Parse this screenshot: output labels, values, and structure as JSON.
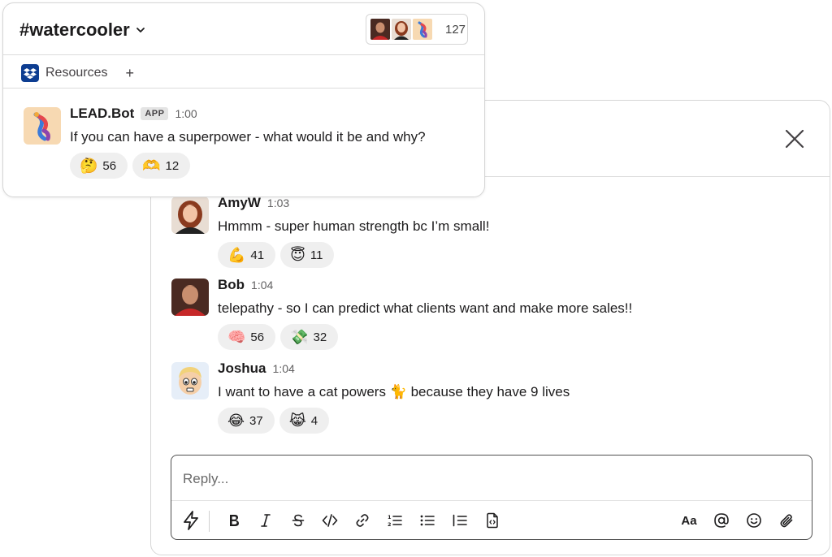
{
  "channel": {
    "name": "#watercooler",
    "member_count": "127",
    "bookmarks": [
      {
        "label": "Resources",
        "icon": "dropbox-icon"
      }
    ],
    "add_bookmark": "+"
  },
  "parent_message": {
    "author": "LEAD.Bot",
    "badge": "APP",
    "time": "1:00",
    "text": "If you can have a superpower - what would it be and why?",
    "reactions": [
      {
        "emoji": "🤔",
        "count": "56"
      },
      {
        "emoji": "🫶",
        "count": "12"
      }
    ]
  },
  "thread": {
    "replies": [
      {
        "author": "AmyW",
        "time": "1:03",
        "text": "Hmmm - super human strength bc I’m small!",
        "reactions": [
          {
            "emoji": "💪",
            "count": "41"
          },
          {
            "emoji": "😇",
            "count": "11"
          }
        ]
      },
      {
        "author": "Bob",
        "time": "1:04",
        "text": "telepathy - so I can predict what clients want and make more sales!!",
        "reactions": [
          {
            "emoji": "🧠",
            "count": "56"
          },
          {
            "emoji": "💸",
            "count": "32"
          }
        ]
      },
      {
        "author": "Joshua",
        "time": "1:04",
        "text_before": "I want to have a cat powers",
        "text_emoji": "🐈",
        "text_after": "because they have 9 lives",
        "reactions": [
          {
            "emoji": "😂",
            "count": "37"
          },
          {
            "emoji": "😹",
            "count": "4"
          }
        ]
      }
    ]
  },
  "composer": {
    "placeholder": "Reply...",
    "toolbar_left": [
      "shortcuts-icon",
      "bold-icon",
      "italic-icon",
      "strikethrough-icon",
      "code-icon",
      "link-icon",
      "ordered-list-icon",
      "bulleted-list-icon",
      "blockquote-icon",
      "code-block-icon"
    ],
    "toolbar_right": [
      "formatting-icon",
      "mention-icon",
      "emoji-icon",
      "attach-icon"
    ],
    "format_label": "Aa"
  },
  "colors": {
    "background": "#ffffff",
    "border": "#d6d6d6",
    "reaction_bg": "#efefef",
    "text": "#1d1c1d",
    "muted": "#616061",
    "dropbox_blue": "#0d3d91"
  }
}
